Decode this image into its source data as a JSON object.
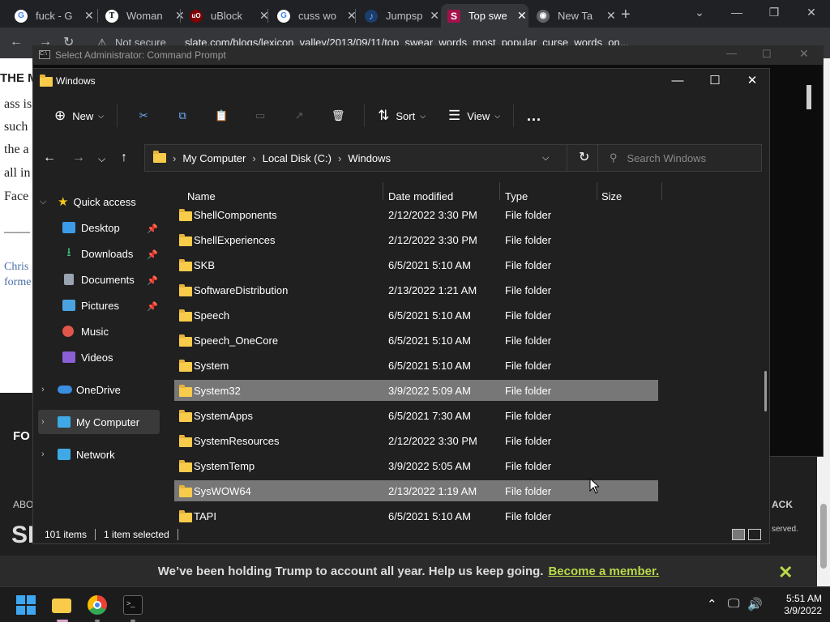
{
  "browser": {
    "tabs": [
      {
        "title": "fuck - G",
        "favicon": "google-g",
        "active": false
      },
      {
        "title": "Woman",
        "favicon": "nyt-t",
        "active": false
      },
      {
        "title": "uBlock",
        "favicon": "ublock",
        "active": false
      },
      {
        "title": "cuss wo",
        "favicon": "google-g",
        "active": false
      },
      {
        "title": "Jumpsp",
        "favicon": "music-note",
        "active": false
      },
      {
        "title": "Top swe",
        "favicon": "slate-s",
        "active": true
      },
      {
        "title": "New Ta",
        "favicon": "chrome",
        "active": false
      }
    ],
    "new_tab_label": "+",
    "security_label": "Not secure",
    "url": "slate.com/blogs/lexicon_valley/2013/09/11/top_swear_words_most_popular_curse_words_on..."
  },
  "background_page": {
    "text_lines": [
      "THE M",
      "ass is",
      "such",
      "the a",
      "all in",
      "Face",
      "——",
      "Chris",
      "forme"
    ],
    "footer_left": [
      "FO",
      "ABO",
      "SL"
    ],
    "footer_right": [
      "ACK",
      "served."
    ],
    "banner_text": "We’ve been holding Trump to account all year. Help us keep going.",
    "banner_link": "Become a member."
  },
  "cmd_window": {
    "title": "Select Administrator: Command Prompt"
  },
  "explorer": {
    "title": "Windows",
    "toolbar": {
      "new_label": "New",
      "sort_label": "Sort",
      "view_label": "View",
      "more_label": "..."
    },
    "breadcrumb": [
      "My Computer",
      "Local Disk (C:)",
      "Windows"
    ],
    "search_placeholder": "Search Windows",
    "nav": {
      "quick_access": "Quick access",
      "desktop": "Desktop",
      "downloads": "Downloads",
      "documents": "Documents",
      "pictures": "Pictures",
      "music": "Music",
      "videos": "Videos",
      "onedrive": "OneDrive",
      "my_computer": "My Computer",
      "network": "Network"
    },
    "columns": {
      "name": "Name",
      "date": "Date modified",
      "type": "Type",
      "size": "Size"
    },
    "rows": [
      {
        "name": "ShellComponents",
        "date": "2/12/2022 3:30 PM",
        "type": "File folder",
        "selected": false
      },
      {
        "name": "ShellExperiences",
        "date": "2/12/2022 3:30 PM",
        "type": "File folder",
        "selected": false
      },
      {
        "name": "SKB",
        "date": "6/5/2021 5:10 AM",
        "type": "File folder",
        "selected": false
      },
      {
        "name": "SoftwareDistribution",
        "date": "2/13/2022 1:21 AM",
        "type": "File folder",
        "selected": false
      },
      {
        "name": "Speech",
        "date": "6/5/2021 5:10 AM",
        "type": "File folder",
        "selected": false
      },
      {
        "name": "Speech_OneCore",
        "date": "6/5/2021 5:10 AM",
        "type": "File folder",
        "selected": false
      },
      {
        "name": "System",
        "date": "6/5/2021 5:10 AM",
        "type": "File folder",
        "selected": false
      },
      {
        "name": "System32",
        "date": "3/9/2022 5:09 AM",
        "type": "File folder",
        "selected": true
      },
      {
        "name": "SystemApps",
        "date": "6/5/2021 7:30 AM",
        "type": "File folder",
        "selected": false
      },
      {
        "name": "SystemResources",
        "date": "2/12/2022 3:30 PM",
        "type": "File folder",
        "selected": false
      },
      {
        "name": "SystemTemp",
        "date": "3/9/2022 5:05 AM",
        "type": "File folder",
        "selected": false
      },
      {
        "name": "SysWOW64",
        "date": "2/13/2022 1:19 AM",
        "type": "File folder",
        "selected": true
      },
      {
        "name": "TAPI",
        "date": "6/5/2021 5:10 AM",
        "type": "File folder",
        "selected": false
      }
    ],
    "status": {
      "count": "101 items",
      "selection": "1 item selected"
    }
  },
  "taskbar": {
    "time": "5:51 AM",
    "date": "3/9/2022"
  },
  "colors": {
    "explorer_bg": "#202020",
    "selection": "#777777",
    "folder": "#f8cb4a",
    "banner_link": "#b9d94a"
  }
}
